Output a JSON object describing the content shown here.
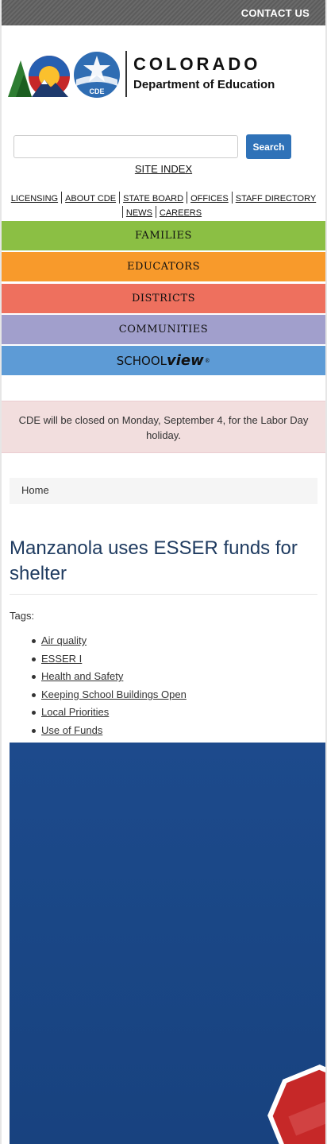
{
  "header": {
    "contact_label": "CONTACT US",
    "logo": {
      "title": "COLORADO",
      "subtitle": "Department of Education",
      "seal_text": "CDE"
    }
  },
  "search": {
    "placeholder": "",
    "button_label": "Search"
  },
  "site_index_label": "SITE INDEX",
  "utility_nav": {
    "row1": [
      "LICENSING",
      "ABOUT CDE",
      "STATE BOARD",
      "OFFICES",
      "STAFF DIRECTORY"
    ],
    "row2": [
      "NEWS",
      "CAREERS"
    ]
  },
  "audience_nav": [
    {
      "label": "FAMILIES",
      "color": "#8bbf44"
    },
    {
      "label": "EDUCATORS",
      "color": "#f89a2b"
    },
    {
      "label": "DISTRICTS",
      "color": "#ee705e"
    },
    {
      "label": "COMMUNITIES",
      "color": "#a19fcc"
    }
  ],
  "schoolview": {
    "part1": "SCHOOL",
    "part2": "view",
    "mark": "®",
    "color": "#5d9bd6"
  },
  "alert": {
    "text": "CDE will be closed on Monday, September 4, for the Labor Day holiday."
  },
  "breadcrumb": {
    "home": "Home"
  },
  "article": {
    "title": "Manzanola uses ESSER funds for shelter",
    "tags_label": "Tags:",
    "tags": [
      "Air quality",
      "ESSER I",
      "Health and Safety",
      "Keeping School Buildings Open",
      "Local Priorities",
      "Use of Funds"
    ]
  },
  "colors": {
    "title": "#1f3b60",
    "search_button": "#2f72b8",
    "alert_bg": "#f2dede"
  }
}
